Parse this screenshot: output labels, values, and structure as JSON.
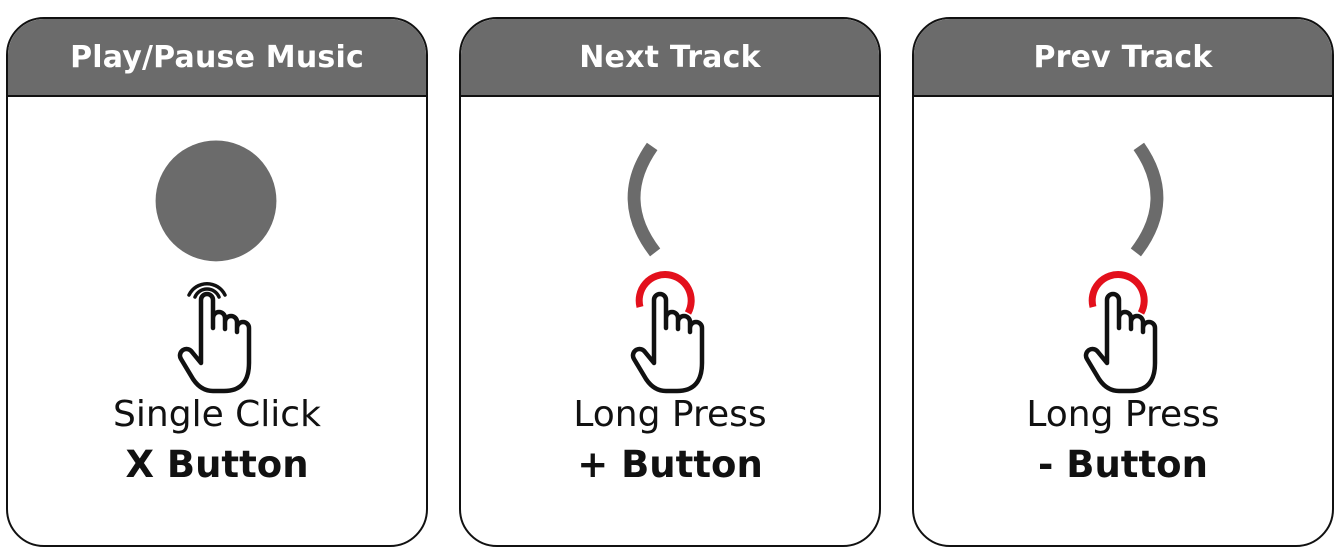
{
  "colors": {
    "header_bg": "#6b6b6b",
    "symbol_gray": "#6b6b6b",
    "press_red": "#e3101c",
    "outline": "#111111"
  },
  "cards": [
    {
      "title": "Play/Pause Music",
      "symbol": "filled-circle",
      "press_indicator": "tap-rings-black",
      "gesture": "Single Click",
      "button": "X Button"
    },
    {
      "title": "Next Track",
      "symbol": "left-parenthesis-arc",
      "press_indicator": "press-ring-red",
      "gesture": "Long Press",
      "button": "+ Button"
    },
    {
      "title": "Prev Track",
      "symbol": "right-parenthesis-arc",
      "press_indicator": "press-ring-red",
      "gesture": "Long Press",
      "button": "- Button"
    }
  ]
}
